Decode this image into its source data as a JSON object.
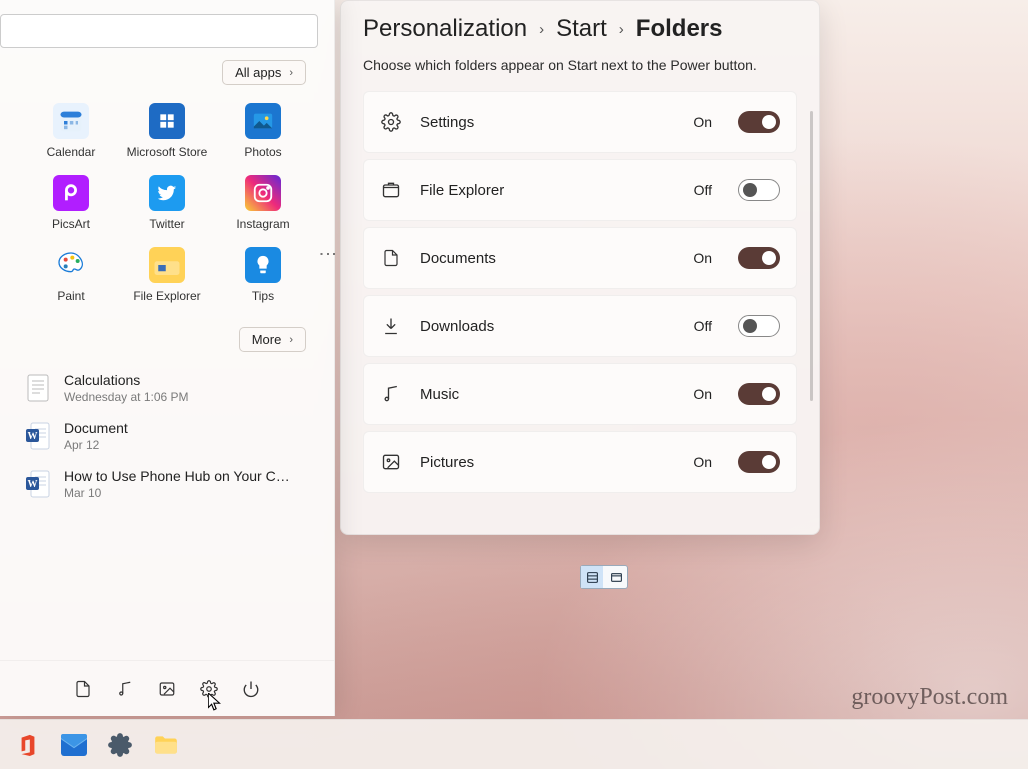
{
  "breadcrumb": {
    "level1": "Personalization",
    "level2": "Start",
    "level3": "Folders"
  },
  "settings_desc": "Choose which folders appear on Start next to the Power button.",
  "on_label": "On",
  "off_label": "Off",
  "folders": [
    {
      "name": "Settings",
      "icon": "gear",
      "state": "On"
    },
    {
      "name": "File Explorer",
      "icon": "folder",
      "state": "Off"
    },
    {
      "name": "Documents",
      "icon": "document",
      "state": "On"
    },
    {
      "name": "Downloads",
      "icon": "download",
      "state": "Off"
    },
    {
      "name": "Music",
      "icon": "music",
      "state": "On"
    },
    {
      "name": "Pictures",
      "icon": "picture",
      "state": "On"
    }
  ],
  "start": {
    "all_apps": "All apps",
    "more": "More",
    "pinned": [
      {
        "name": "Calendar"
      },
      {
        "name": "Microsoft Store"
      },
      {
        "name": "Photos"
      },
      {
        "name": "PicsArt"
      },
      {
        "name": "Twitter"
      },
      {
        "name": "Instagram"
      },
      {
        "name": "Paint"
      },
      {
        "name": "File Explorer"
      },
      {
        "name": "Tips"
      }
    ],
    "recommended": [
      {
        "title": "Calculations",
        "sub": "Wednesday at 1:06 PM",
        "type": "txt"
      },
      {
        "title": "Document",
        "sub": "Apr 12",
        "type": "word"
      },
      {
        "title": "How to Use Phone Hub on Your Ch…",
        "sub": "Mar 10",
        "type": "word"
      }
    ],
    "footer_icons": [
      "documents",
      "music",
      "pictures",
      "settings",
      "power"
    ]
  },
  "watermark": "groovyPost.com"
}
